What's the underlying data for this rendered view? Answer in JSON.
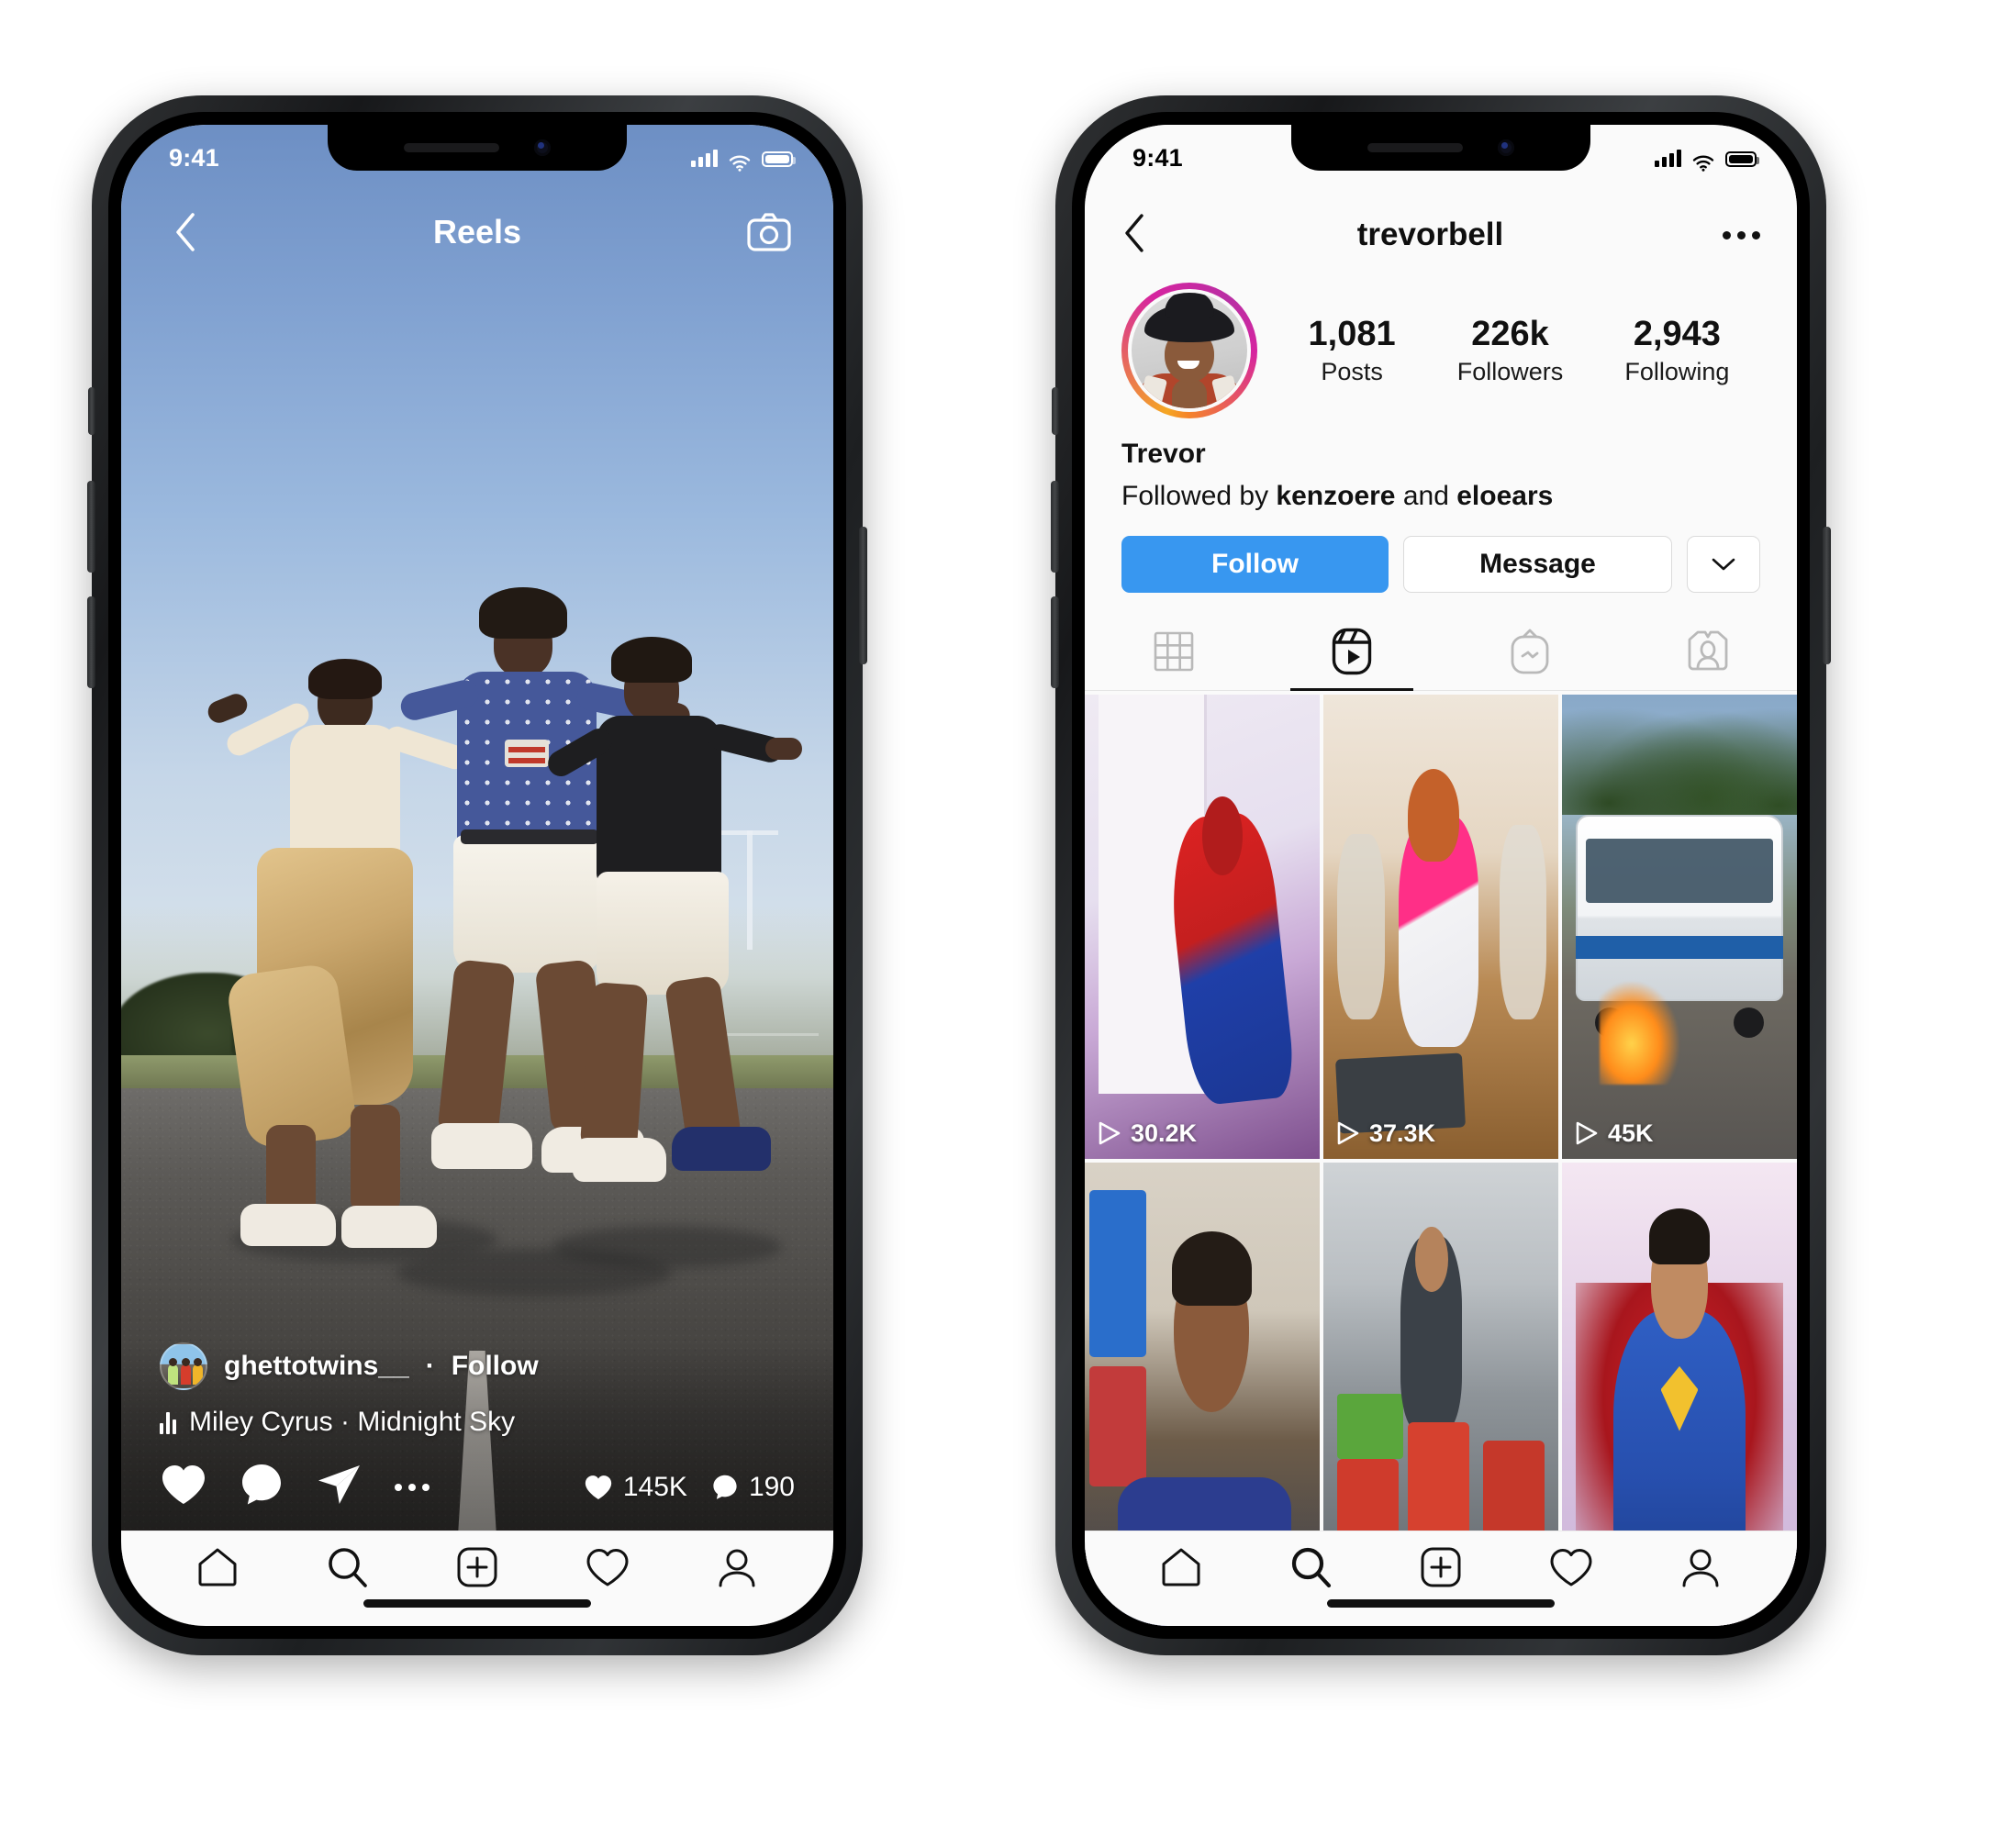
{
  "reels_phone": {
    "status_bar": {
      "time": "9:41",
      "signal_icon": "cellular-bars-icon",
      "wifi_icon": "wifi-icon",
      "battery_icon": "battery-icon"
    },
    "header": {
      "back_icon": "chevron-left-icon",
      "title": "Reels",
      "camera_icon": "camera-icon"
    },
    "overlay": {
      "username": "ghettotwins__",
      "separator": "·",
      "follow_label": "Follow",
      "music_icon": "audio-equalizer-icon",
      "music": "Miley Cyrus · Midnight Sky",
      "actions": [
        {
          "name": "like-icon",
          "label": "like"
        },
        {
          "name": "comment-icon",
          "label": "comment"
        },
        {
          "name": "share-icon",
          "label": "share"
        },
        {
          "name": "more-options-icon",
          "label": "more"
        }
      ],
      "like_count": "145K",
      "comment_count": "190"
    },
    "tabbar": [
      {
        "name": "home-icon",
        "label": "Home"
      },
      {
        "name": "search-icon",
        "label": "Search"
      },
      {
        "name": "add-post-icon",
        "label": "New post"
      },
      {
        "name": "activity-heart-icon",
        "label": "Activity"
      },
      {
        "name": "profile-icon",
        "label": "Profile"
      }
    ]
  },
  "profile_phone": {
    "status_bar": {
      "time": "9:41",
      "signal_icon": "cellular-bars-icon",
      "wifi_icon": "wifi-icon",
      "battery_icon": "battery-icon"
    },
    "nav": {
      "back_icon": "chevron-left-icon",
      "title": "trevorbell",
      "more_icon": "more-options-icon"
    },
    "avatar_name": "profile-avatar",
    "stats": [
      {
        "value": "1,081",
        "label": "Posts"
      },
      {
        "value": "226k",
        "label": "Followers"
      },
      {
        "value": "2,943",
        "label": "Following"
      }
    ],
    "bio": {
      "display_name": "Trevor",
      "followed_by_prefix": "Followed by ",
      "followed_by_1": "kenzoere",
      "followed_by_join": " and ",
      "followed_by_2": "eloears"
    },
    "buttons": {
      "follow": "Follow",
      "message": "Message",
      "caret_icon": "chevron-down-icon"
    },
    "tabs": [
      {
        "name": "grid-tab",
        "icon": "grid-icon",
        "active": false
      },
      {
        "name": "reels-tab",
        "icon": "reels-icon",
        "active": true
      },
      {
        "name": "igtv-tab",
        "icon": "igtv-icon",
        "active": false
      },
      {
        "name": "tagged-tab",
        "icon": "tagged-person-icon",
        "active": false
      }
    ],
    "grid": [
      {
        "art": "t1",
        "views": "30.2K",
        "show_views": true
      },
      {
        "art": "t2",
        "views": "37.3K",
        "show_views": true
      },
      {
        "art": "t3",
        "views": "45K",
        "show_views": true
      },
      {
        "art": "t4",
        "views": "",
        "show_views": false
      },
      {
        "art": "t5",
        "views": "",
        "show_views": false
      },
      {
        "art": "t6",
        "views": "",
        "show_views": false
      }
    ],
    "tabbar": [
      {
        "name": "home-icon",
        "label": "Home"
      },
      {
        "name": "search-icon",
        "label": "Search"
      },
      {
        "name": "add-post-icon",
        "label": "New post"
      },
      {
        "name": "activity-heart-icon",
        "label": "Activity"
      },
      {
        "name": "profile-icon",
        "label": "Profile"
      }
    ]
  },
  "colors": {
    "instagram_blue": "#3897f0",
    "page_bg": "#ffffff",
    "screen_bg": "#fafafa",
    "text_primary": "#111111",
    "border": "#dbdbdb"
  }
}
